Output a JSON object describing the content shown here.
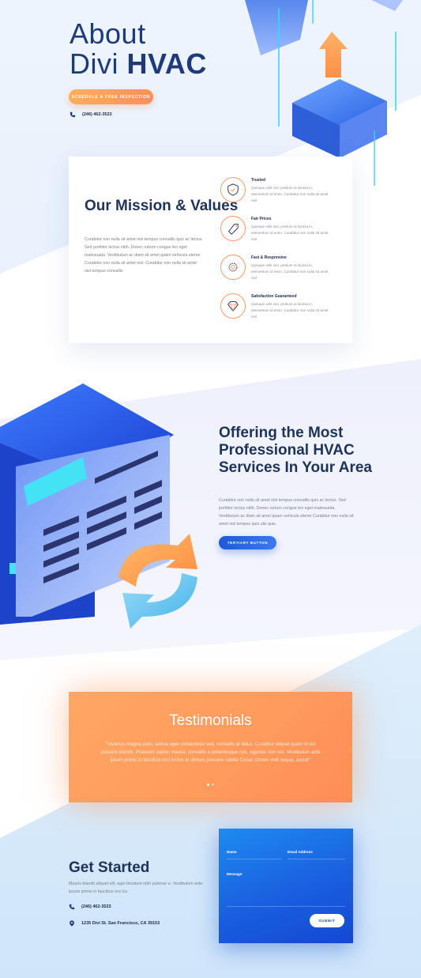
{
  "colors": {
    "navy": "#1d3458",
    "orange": "#ff9a5c",
    "blue": "#1a5fe0",
    "text_gray": "#7a7f88"
  },
  "hero": {
    "title_line1": "About",
    "title_prefix": "Divi",
    "title_strong": "HVAC",
    "cta_label": "SCHEDULE A FREE INSPECTION",
    "phone": "(246) 462-3523",
    "phone_icon": "phone-icon"
  },
  "mission": {
    "title": "Our Mission & Values",
    "body": "Curabitur non nulla sit amet nisl tempus convallis quis ac lectus. Sed porttitor lectus nibh. Donec rutrum congue leo eget malesuada. Vestibulum ac diam sit amet quam vehicula eleme Curabitur non nulla sit amet nisl. Curabitur non nulla sit amet nisl tempus convallis",
    "features": [
      {
        "title": "Trusted",
        "desc": "Quisque velit nisi, pretium ut lacinia in, elementum id enim. Curabitur non nulla sit amet nisl",
        "icon": "shield-icon"
      },
      {
        "title": "Fair Prices",
        "desc": "Quisque velit nisi, pretium ut lacinia in, elementum id enim. Curabitur non nulla sit amet nisl",
        "icon": "price-tag-icon"
      },
      {
        "title": "Fast & Responsive",
        "desc": "Quisque velit nisi, pretium ut lacinia in, elementum id enim. Curabitur non nulla sit amet nisl",
        "icon": "gear-icon"
      },
      {
        "title": "Satisfaction Guaranteed",
        "desc": "Quisque velit nisi, pretium ut lacinia in, elementum id enim. Curabitur non nulla sit amet nisl",
        "icon": "diamond-icon"
      }
    ]
  },
  "offering": {
    "title": "Offering the Most Professional HVAC Services In Your Area",
    "body": "Curabitur non nulla sit amet nisl tempus convallis quis ac lectus. Sed porttitor lectus nibh. Donec rutrum congue leo eget malesuada. Vestibulum ac diam sit amet quam vehicula eleme Curabitur non nulla sit amet nisl tempus quis ulis quis.",
    "button_label": "TERTIARY BUTTON"
  },
  "testimonials": {
    "title": "Testimonials",
    "quote": "\"Vivamus magna justo, lacinia eget consectetur sed, convallis at tellus. Curabitur aliquet quam id dui posuere blandit. Praesent sapien massa, convallis a pellentesque nec, egestas non nisi. Vestibulum ante ipsum primis in faucibus orci luctus et ultrices posuere cubilia Curae; Donec velit neque, auctor\""
  },
  "get_started": {
    "title": "Get Started",
    "body": "Mauris blandit aliquet elit, eget tincidunt nibh pulvinar a. Vestibulum ante ipsum primis in faucibus orci luc",
    "phone": "(246) 462-3523",
    "address": "1235 Divi St. San Francisco, CA 39153",
    "phone_icon": "phone-icon",
    "location_icon": "map-pin-icon"
  },
  "form": {
    "name_label": "Name",
    "email_label": "Email Address",
    "message_label": "Message",
    "submit_label": "SUBMIT"
  }
}
